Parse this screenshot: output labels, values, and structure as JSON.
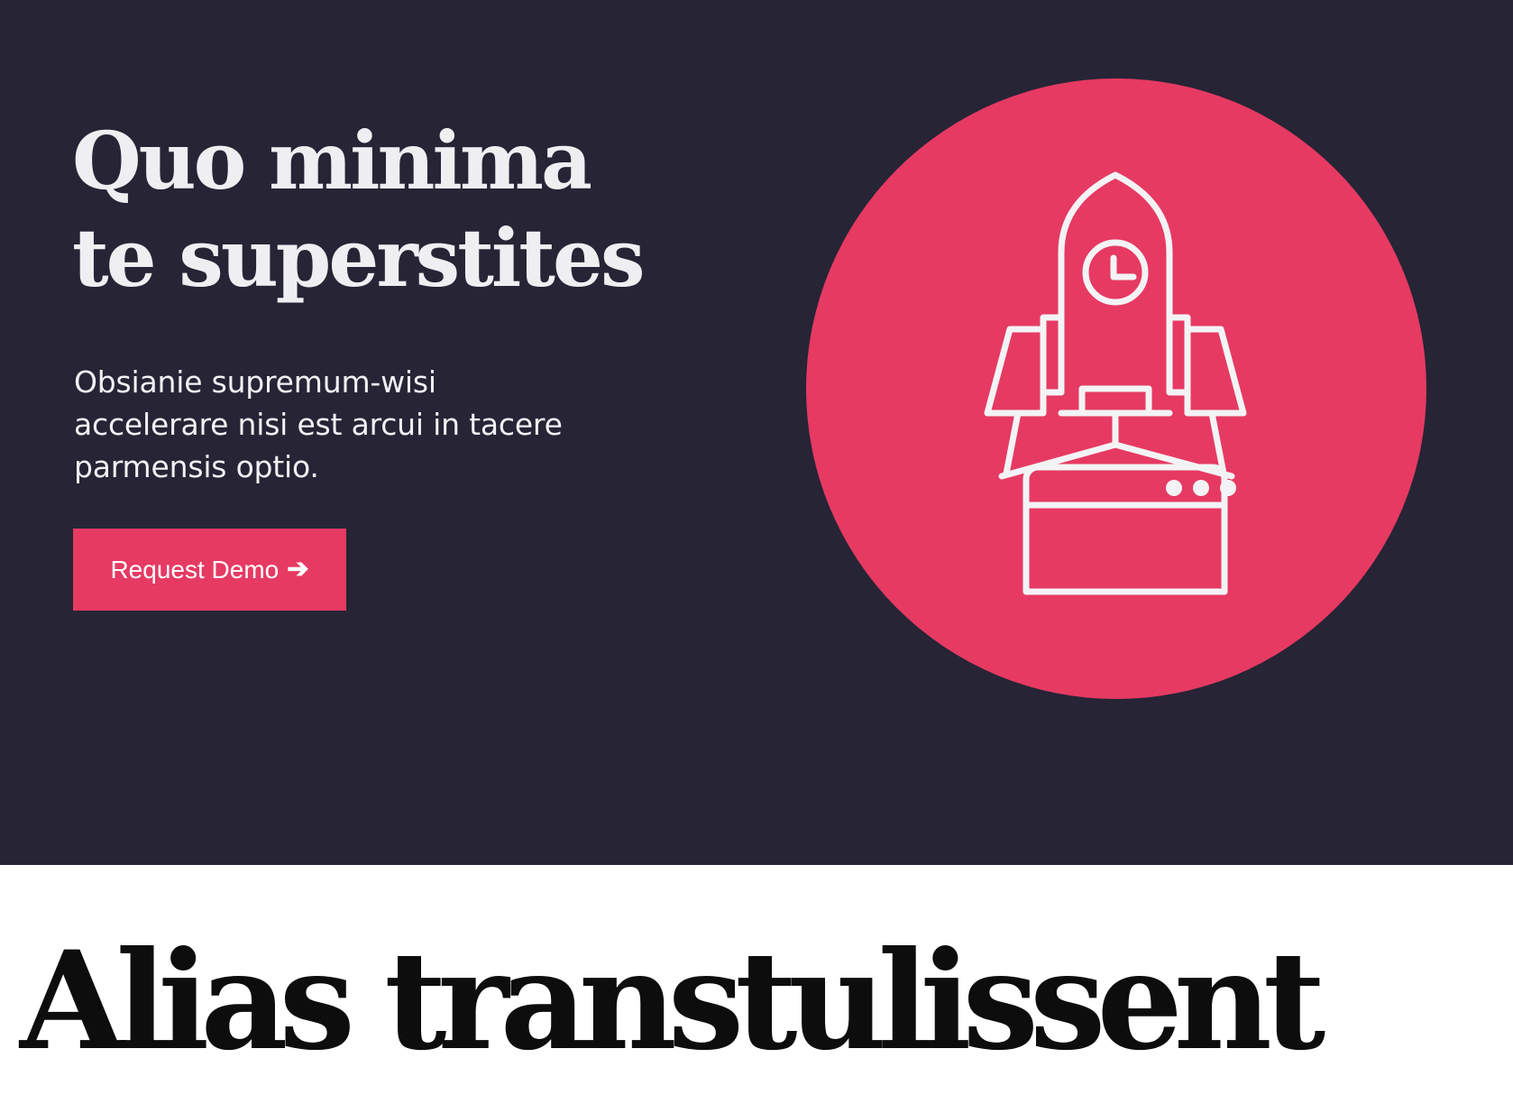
{
  "hero": {
    "title_lines": [
      "Quo minima",
      "te superstites"
    ],
    "subtitle_lines": [
      "Obsianie supremum-wisi",
      "accelerare nisi est arcui in tacere",
      "parmensis optio."
    ],
    "cta": {
      "label": "Request Demo",
      "arrow": "➔"
    },
    "illustration": {
      "icon": "rocket-launch-icon"
    }
  },
  "section": {
    "title": "Alias transtulissent"
  },
  "colors": {
    "hero_background": "#262435",
    "accent": "#e63a63",
    "hero_text": "#efeff2",
    "page_background": "#ffffff",
    "section_title": "#0d0d0d"
  }
}
